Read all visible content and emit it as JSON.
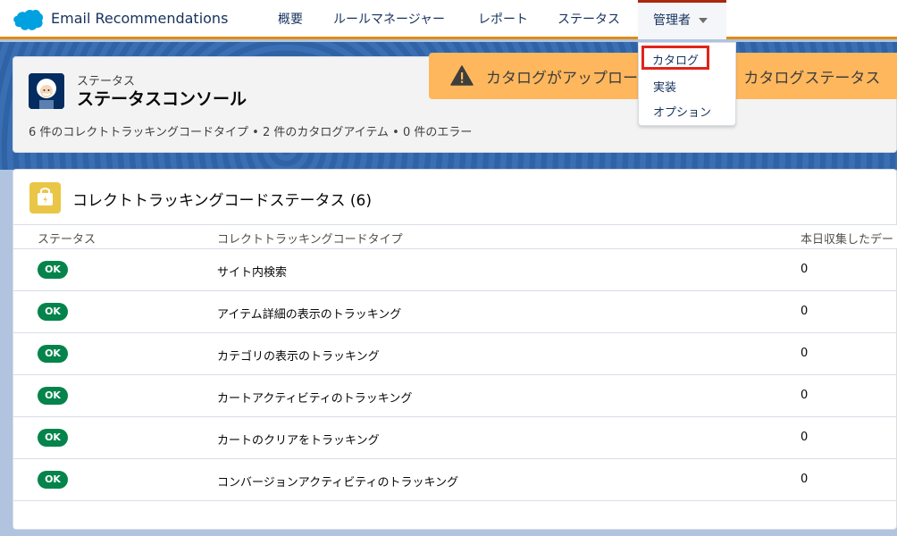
{
  "app": {
    "name": "Email Recommendations",
    "logo_icon": "salesforce-cloud-icon",
    "brand_color": "#00a1e0"
  },
  "nav": {
    "items": [
      {
        "label": "概要"
      },
      {
        "label": "ルールマネージャー"
      },
      {
        "label": "レポート"
      },
      {
        "label": "ステータス"
      }
    ],
    "admin": {
      "label": "管理者",
      "icon": "chevron-down-icon"
    }
  },
  "dropdown": {
    "items": [
      {
        "label": "カタログ"
      },
      {
        "label": "実装"
      },
      {
        "label": "オプション"
      }
    ],
    "highlight_color": "#e2231a"
  },
  "header": {
    "subtitle": "ステータス",
    "title": "ステータスコンソール",
    "meta": "6 件のコレクトトラッキングコードタイプ • 2 件のカタログアイテム • 0 件のエラー",
    "avatar_icon": "einstein-avatar-icon"
  },
  "toast": {
    "text": "カタログがアップロードされるまで、カタログステータス",
    "icon": "warning-icon",
    "color": "#ffb75d"
  },
  "card": {
    "title": "コレクトトラッキングコードステータス (6)",
    "icon": "locker-icon",
    "columns": [
      "ステータス",
      "コレクトトラッキングコードタイプ",
      "本日収集したデー"
    ],
    "rows": [
      {
        "status": "OK",
        "type": "サイト内検索",
        "count": "0"
      },
      {
        "status": "OK",
        "type": "アイテム詳細の表示のトラッキング",
        "count": "0"
      },
      {
        "status": "OK",
        "type": "カテゴリの表示のトラッキング",
        "count": "0"
      },
      {
        "status": "OK",
        "type": "カートアクティビティのトラッキング",
        "count": "0"
      },
      {
        "status": "OK",
        "type": "カートのクリアをトラッキング",
        "count": "0"
      },
      {
        "status": "OK",
        "type": "コンバージョンアクティビティのトラッキング",
        "count": "0"
      }
    ],
    "status_color": "#04844b"
  }
}
